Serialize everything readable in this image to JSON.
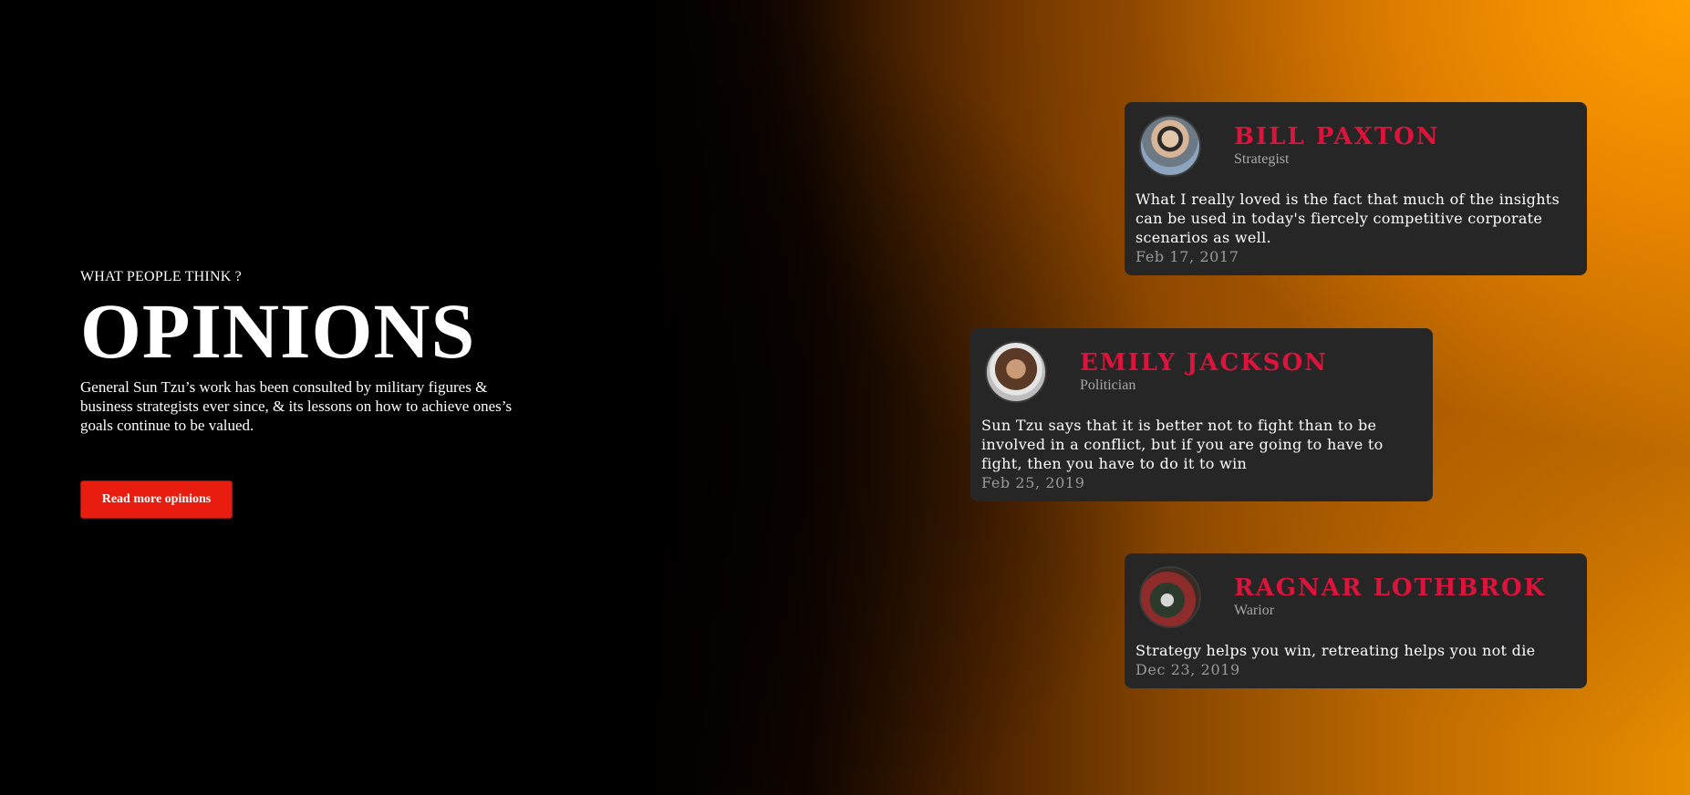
{
  "hero": {
    "eyebrow": "WHAT PEOPLE THINK ?",
    "title": "OPINIONS",
    "description": "General Sun Tzu’s work has been consulted by military figures & business strategists ever since, & its lessons on how to achieve ones’s goals continue to be valued.",
    "cta_label": "Read more opinions"
  },
  "colors": {
    "accent_name": "#dc143c",
    "button": "#e81c0f",
    "card_background": "#262626",
    "gradient_orange": "#e88e00"
  },
  "testimonials": [
    {
      "name": "BILL PAXTON",
      "role": "Strategist",
      "quote": "What I really loved is the fact that much of the insights can be used in today's fiercely competitive corporate scenarios as well.",
      "date": "Feb 17, 2017",
      "avatar_icon": "avatar-photo"
    },
    {
      "name": "EMILY JACKSON",
      "role": "Politician",
      "quote": "Sun Tzu says that it is better not to fight than to be involved in a conflict, but if you are going to have to fight, then you have to do it to win",
      "date": "Feb 25, 2019",
      "avatar_icon": "avatar-photo"
    },
    {
      "name": "RAGNAR LOTHBROK",
      "role": "Warior",
      "quote": "Strategy helps you win, retreating helps you not die",
      "date": "Dec 23, 2019",
      "avatar_icon": "avatar-photo"
    }
  ]
}
